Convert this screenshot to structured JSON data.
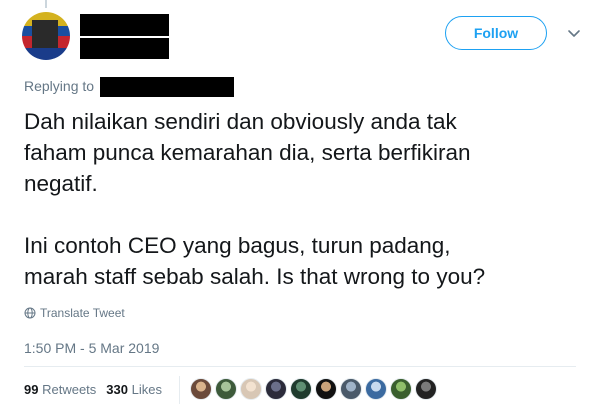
{
  "tweet": {
    "follow_label": "Follow",
    "replying_label": "Replying to",
    "text": "Dah nilaikan sendiri dan obviously anda tak\nfaham punca kemarahan dia, serta berfikiran\nnegatif.\n\nIni contoh CEO yang bagus, turun padang,\nmarah staff sebab salah. Is that wrong to you?",
    "translate_label": "Translate Tweet",
    "timestamp": "1:50 PM - 5 Mar 2019"
  },
  "stats": {
    "retweets_count": "99",
    "retweets_label": "Retweets",
    "likes_count": "330",
    "likes_label": "Likes"
  },
  "colors": {
    "accent": "#1da1f2",
    "secondary_text": "#657786",
    "primary_text": "#14171a"
  },
  "likers": [
    {
      "colors": [
        "#6b4a3a",
        "#d9b38c"
      ]
    },
    {
      "colors": [
        "#3d5a3a",
        "#a7c49a"
      ]
    },
    {
      "colors": [
        "#d8c7b5",
        "#f3e2d0"
      ]
    },
    {
      "colors": [
        "#2b2b3a",
        "#6b6f8a"
      ]
    },
    {
      "colors": [
        "#1f3b2e",
        "#5f8f73"
      ]
    },
    {
      "colors": [
        "#111111",
        "#c9a27a"
      ]
    },
    {
      "colors": [
        "#4a5a6a",
        "#9fb3c8"
      ]
    },
    {
      "colors": [
        "#3b6aa0",
        "#c7d9ee"
      ]
    },
    {
      "colors": [
        "#3a5f2e",
        "#8fbf6a"
      ]
    },
    {
      "colors": [
        "#222222",
        "#7a7a7a"
      ]
    }
  ]
}
